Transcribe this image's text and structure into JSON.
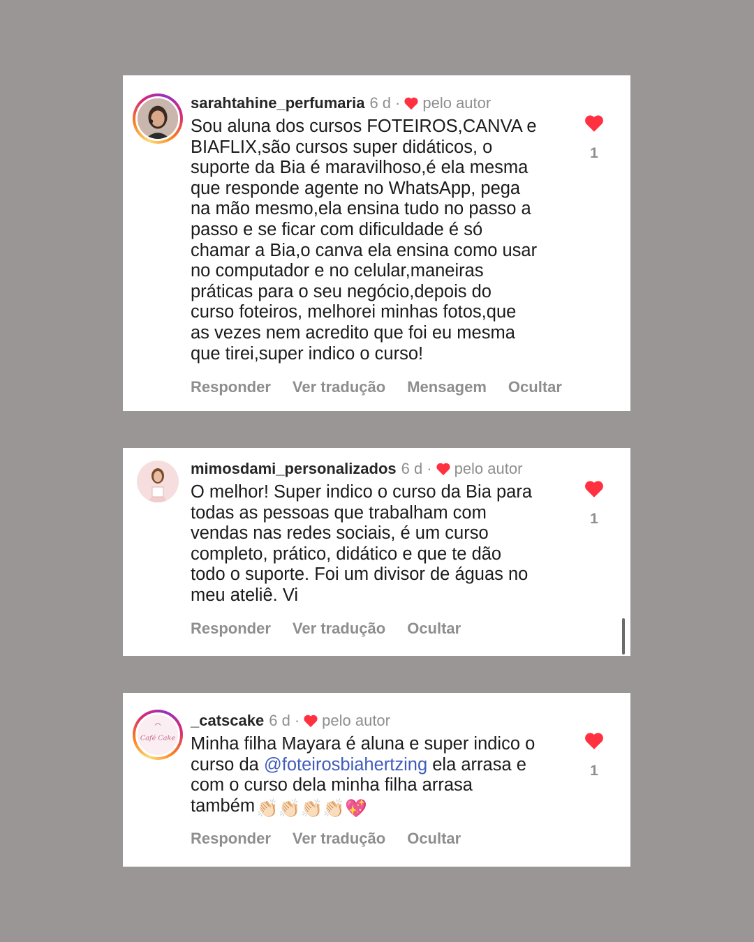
{
  "comments": [
    {
      "username": "sarahtahine_perfumaria",
      "time": "6 d",
      "separator": "·",
      "author_like": "pelo autor",
      "text": "Sou aluna dos cursos FOTEIROS,CANVA e\nBIAFLIX,são cursos super didáticos, o\nsuporte da Bia é maravilhoso,é ela mesma\nque responde agente no WhatsApp, pega\nna mão mesmo,ela ensina tudo no passo a\npasso e se ficar com dificuldade é só\nchamar a Bia,o canva ela ensina como usar\nno computador e no celular,maneiras\npráticas para o seu negócio,depois do\ncurso foteiros, melhorei minhas fotos,que\nas vezes nem acredito que foi eu mesma\nque tirei,super indico o curso!",
      "likes": "1",
      "actions": [
        "Responder",
        "Ver tradução",
        "Mensagem",
        "Ocultar"
      ]
    },
    {
      "username": "mimosdami_personalizados",
      "time": "6 d",
      "separator": "·",
      "author_like": "pelo autor",
      "text": "O melhor! Super indico o curso da Bia para\ntodas as pessoas que trabalham com\nvendas nas redes sociais, é um curso\ncompleto, prático, didático e que te dão\ntodo o suporte. Foi um divisor de águas no\nmeu ateliê. Vi",
      "likes": "1",
      "actions": [
        "Responder",
        "Ver tradução",
        "Ocultar"
      ]
    },
    {
      "username": "_catscake",
      "time": "6 d",
      "separator": "·",
      "author_like": "pelo autor",
      "text_before": "Minha filha Mayara é aluna e super indico o\ncurso da ",
      "mention": "@foteirosbiahertzing",
      "text_after": " ela arrasa e\ncom o curso dela minha filha arrasa\ntambém",
      "emojis": "👏🏻👏🏻👏🏻👏🏻💖",
      "avatar_logo": "Café Cake",
      "likes": "1",
      "actions": [
        "Responder",
        "Ver tradução",
        "Ocultar"
      ]
    }
  ],
  "colors": {
    "background": "#9a9696",
    "card": "#ffffff",
    "heart": "#ff3040",
    "meta_gray": "#8e8e8e",
    "mention": "#3f5bbd"
  }
}
